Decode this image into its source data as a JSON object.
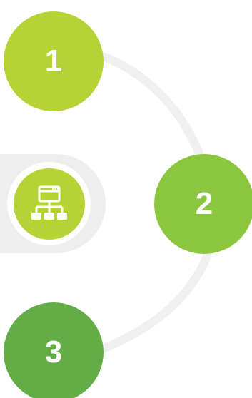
{
  "steps": [
    {
      "label": "1",
      "color": "#b5d334"
    },
    {
      "label": "2",
      "color": "#8cc63e"
    },
    {
      "label": "3",
      "color": "#64ad46"
    }
  ],
  "connector_color": "#f0f0f0",
  "panel": {
    "background": "#eeeeee",
    "icon": "network-hierarchy-icon",
    "icon_color": "#b5d334"
  }
}
